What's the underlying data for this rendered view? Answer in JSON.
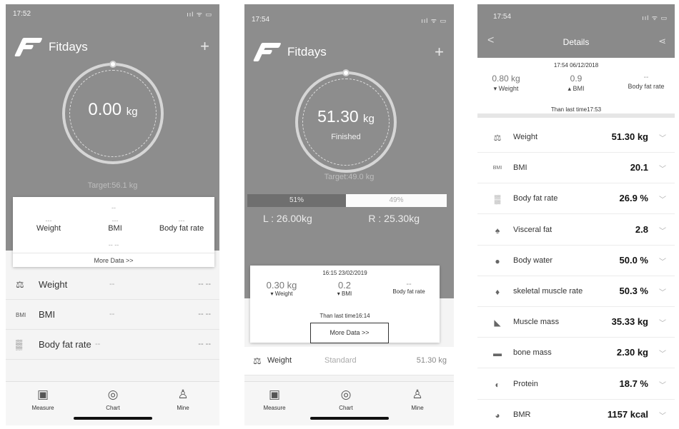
{
  "screen1": {
    "status": {
      "time": "17:52",
      "signal": "ııl ᯤ ▭"
    },
    "brand": "Fitdays",
    "plus": "+",
    "weight_value": "0.00",
    "weight_unit": "kg",
    "target": "Target:56.1 kg",
    "card": {
      "top_dash": "--",
      "cells": [
        {
          "value": "---",
          "label": "Weight"
        },
        {
          "value": "---",
          "label": "BMI"
        },
        {
          "value": "---",
          "label": "Body fat rate"
        }
      ],
      "sub_dash": "-- --",
      "more": "More Data >>"
    },
    "rows": [
      {
        "name": "Weight",
        "mid": "--",
        "right": "-- --"
      },
      {
        "name": "BMI",
        "icon_text": "BMI",
        "mid": "--",
        "right": "-- --"
      },
      {
        "name": "Body fat rate",
        "mid": "--",
        "right": "-- --"
      }
    ],
    "tabs": [
      {
        "label": "Measure",
        "icon": "scale-icon"
      },
      {
        "label": "Chart",
        "icon": "chart-icon"
      },
      {
        "label": "Mine",
        "icon": "person-icon"
      }
    ]
  },
  "screen2": {
    "status": {
      "time": "17:54",
      "signal": "ııl ᯤ ▭"
    },
    "brand": "Fitdays",
    "plus": "+",
    "weight_value": "51.30",
    "weight_unit": "kg",
    "finished": "Finished",
    "target": "Target:49.0 kg",
    "left_pct": "51%",
    "right_pct": "49%",
    "left_kg": "L : 26.00kg",
    "right_kg": "R : 25.30kg",
    "card": {
      "stamp": "16:15 23/02/2019",
      "cells": [
        {
          "value": "0.30 kg",
          "label": "▾ Weight"
        },
        {
          "value": "0.2",
          "label": "▾ BMI"
        },
        {
          "value": "--",
          "label": "Body fat rate"
        }
      ],
      "than": "Than last time16:14",
      "more": "More Data >>"
    },
    "row": {
      "name": "Weight",
      "mid": "Standard",
      "right": "51.30 kg"
    },
    "tabs": [
      {
        "label": "Measure"
      },
      {
        "label": "Chart"
      },
      {
        "label": "Mine"
      }
    ]
  },
  "screen3": {
    "status": {
      "time": "17:54",
      "signal": "ııl ᯤ ▭"
    },
    "back": "<",
    "title": "Details",
    "share": "⋖",
    "stamp": "17:54 06/12/2018",
    "summary": [
      {
        "value": "0.80 kg",
        "label": "▾ Weight"
      },
      {
        "value": "0.9",
        "label": "▴ BMI"
      },
      {
        "value": "--",
        "label": "Body fat rate"
      }
    ],
    "than": "Than last time17:53",
    "metrics": [
      {
        "name": "Weight",
        "value": "51.30 kg",
        "icon": "scale-icon",
        "glyph": "⚖"
      },
      {
        "name": "BMI",
        "value": "20.1",
        "icon": "bmi-icon",
        "glyph": "BMI"
      },
      {
        "name": "Body fat rate",
        "value": "26.9 %",
        "icon": "body-fat-icon",
        "glyph": "▒"
      },
      {
        "name": "Visceral fat",
        "value": "2.8",
        "icon": "visceral-fat-icon",
        "glyph": "♠"
      },
      {
        "name": "Body water",
        "value": "50.0 %",
        "icon": "water-drop-icon",
        "glyph": "●"
      },
      {
        "name": "skeletal muscle rate",
        "value": "50.3 %",
        "icon": "skeletal-muscle-icon",
        "glyph": "♦"
      },
      {
        "name": "Muscle mass",
        "value": "35.33 kg",
        "icon": "muscle-icon",
        "glyph": "◣"
      },
      {
        "name": "bone mass",
        "value": "2.30 kg",
        "icon": "bone-icon",
        "glyph": "▬"
      },
      {
        "name": "Protein",
        "value": "18.7 %",
        "icon": "protein-icon",
        "glyph": "◐"
      },
      {
        "name": "BMR",
        "value": "1157 kcal",
        "icon": "bmr-icon",
        "glyph": "◕"
      }
    ],
    "chevron": "﹀"
  }
}
